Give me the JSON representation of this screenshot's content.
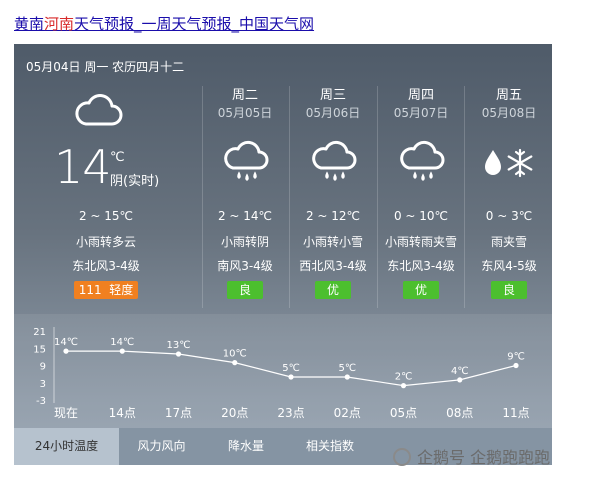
{
  "title": {
    "part1": "黄南",
    "part2": "河南",
    "part3": "天气预报_一周天气预报_中国天气网"
  },
  "date_line": "05月04日 周一 农历四月十二",
  "today": {
    "temp": "14",
    "unit": "℃",
    "tag": "阴(实时)",
    "range": "2 ~ 15℃",
    "weather": "小雨转多云",
    "wind": "东北风3-4级",
    "aqi_num": "111",
    "aqi_label": "轻度",
    "aqi_color": "#f08020"
  },
  "forecast": [
    {
      "day": "周二",
      "date": "05月05日",
      "icon": "cloud-rain-icon",
      "range": "2 ~ 14℃",
      "weather": "小雨转阴",
      "wind": "南风3-4级",
      "aqi": "良"
    },
    {
      "day": "周三",
      "date": "05月06日",
      "icon": "cloud-rain-icon",
      "range": "2 ~ 12℃",
      "weather": "小雨转小雪",
      "wind": "西北风3-4级",
      "aqi": "优"
    },
    {
      "day": "周四",
      "date": "05月07日",
      "icon": "cloud-rain-icon",
      "range": "0 ~ 10℃",
      "weather": "小雨转雨夹雪",
      "wind": "东北风3-4级",
      "aqi": "优"
    },
    {
      "day": "周五",
      "date": "05月08日",
      "icon": "sleet-icon",
      "range": "0 ~ 3℃",
      "weather": "雨夹雪",
      "wind": "东风4-5级",
      "aqi": "良"
    }
  ],
  "aqi_good_color": "#4cbf2e",
  "chart_data": {
    "type": "line",
    "categories": [
      "现在",
      "14点",
      "17点",
      "20点",
      "23点",
      "02点",
      "05点",
      "08点",
      "11点"
    ],
    "values": [
      14,
      14,
      13,
      10,
      5,
      5,
      2,
      4,
      9
    ],
    "point_labels": [
      "14℃",
      "14℃",
      "13℃",
      "10℃",
      "5℃",
      "5℃",
      "2℃",
      "4℃",
      "9℃"
    ],
    "yticks": [
      "21",
      "15",
      "9",
      "3",
      "-3"
    ],
    "ytick_values": [
      21,
      15,
      9,
      3,
      -3
    ],
    "ylim": [
      -3,
      21
    ],
    "grid": false
  },
  "tabs": [
    "24小时温度",
    "风力风向",
    "降水量",
    "相关指数"
  ],
  "watermark": "企鹅号 企鹅跑跑跑"
}
